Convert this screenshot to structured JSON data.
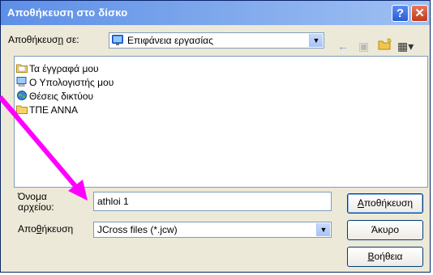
{
  "window": {
    "title": "Αποθήκευση στο δίσκο",
    "help_glyph": "?",
    "close_glyph": "✕"
  },
  "save_in": {
    "label_pre": "Αποθήκευσ",
    "label_u": "η",
    "label_post": " σε:",
    "value": "Επιφάνεια εργασίας",
    "icon": "desktop-icon"
  },
  "toolbar": {
    "back_glyph": "←",
    "up_glyph": "▣",
    "newfolder_glyph": "✱",
    "views_glyph": "▦▾"
  },
  "files": [
    {
      "name": "Τα έγγραφά μου",
      "icon": "my-documents-icon"
    },
    {
      "name": "Ο Υπολογιστής μου",
      "icon": "my-computer-icon"
    },
    {
      "name": "Θέσεις δικτύου",
      "icon": "network-places-icon"
    },
    {
      "name": "ΤΠΕ ΑΝΝΑ",
      "icon": "folder-icon"
    }
  ],
  "filename": {
    "label_line1": "Όνομα",
    "label_line2_pre": "αρ",
    "label_line2_u": "χ",
    "label_line2_post": "είου:",
    "value": "athloi 1"
  },
  "filetype": {
    "label_pre": "Απο",
    "label_u": "θ",
    "label_post": "ήκευση",
    "value": "JCross files (*.jcw)"
  },
  "buttons": {
    "save_pre": "",
    "save_u": "Α",
    "save_post": "ποθήκευση",
    "cancel": "Άκυρο",
    "help_pre": "",
    "help_u": "Β",
    "help_post": "οήθεια"
  },
  "colors": {
    "arrow": "#ff00ff",
    "titlebar": "#5d8fe6"
  }
}
